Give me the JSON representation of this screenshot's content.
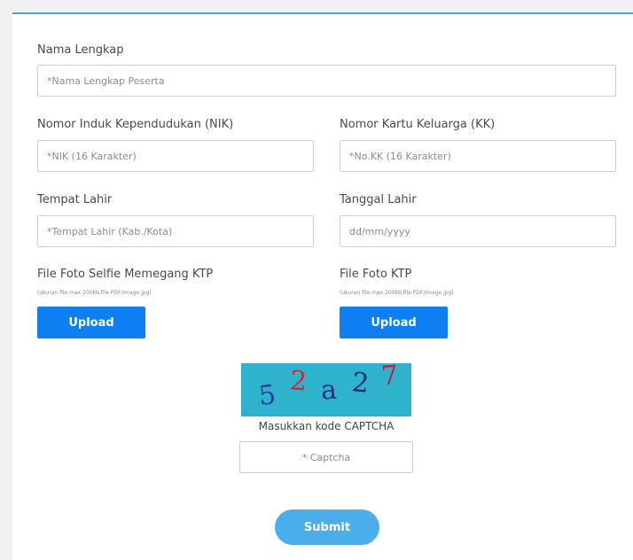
{
  "form": {
    "nama_lengkap": {
      "label": "Nama Lengkap",
      "placeholder": "*Nama Lengkap Peserta",
      "value": ""
    },
    "nik": {
      "label": "Nomor Induk Kependudukan (NIK)",
      "placeholder": "*NIK (16 Karakter)",
      "value": ""
    },
    "kk": {
      "label": "Nomor Kartu Keluarga (KK)",
      "placeholder": "*No.KK (16 Karakter)",
      "value": ""
    },
    "tempat_lahir": {
      "label": "Tempat Lahir",
      "placeholder": "*Tempat Lahir (Kab./Kota)",
      "value": ""
    },
    "tanggal_lahir": {
      "label": "Tanggal Lahir",
      "placeholder": "dd/mm/yyyy",
      "value": ""
    },
    "foto_selfie": {
      "label": "File Foto Selfie Memegang KTP",
      "hint": "(ukuran file max 200kb,file PDF/image jpg)",
      "button": "Upload"
    },
    "foto_ktp": {
      "label": "File Foto KTP",
      "hint": "(ukuran file max 200kb,file PDF/image jpg)",
      "button": "Upload"
    },
    "captcha": {
      "code": "52a27",
      "characters": [
        {
          "char": "5",
          "color": "#2a3d9c"
        },
        {
          "char": "2",
          "color": "#d6243a"
        },
        {
          "char": "a",
          "color": "#25307e"
        },
        {
          "char": "2",
          "color": "#1f2f6e"
        },
        {
          "char": "7",
          "color": "#b82440"
        }
      ],
      "caption": "Masukkan kode CAPTCHA",
      "placeholder": "* Captcha",
      "background": "#2fb3cc"
    },
    "submit_label": "Submit"
  },
  "colors": {
    "accent_line": "#3fa9e0",
    "upload_button": "#0d7ff2",
    "submit_button": "#4badea"
  }
}
